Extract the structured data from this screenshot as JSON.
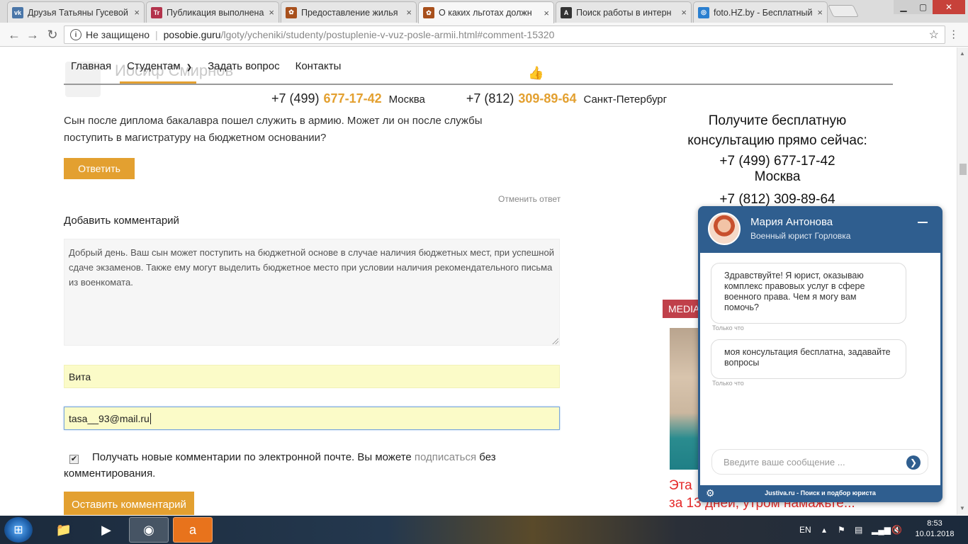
{
  "browser": {
    "tabs": [
      {
        "title": "Друзья Татьяны Гусевой",
        "favicon": "vk-icon",
        "color": "#4a76a8",
        "glyph": "vk"
      },
      {
        "title": "Публикация выполнена",
        "favicon": "tt-icon",
        "color": "#b3334c",
        "glyph": "Tr"
      },
      {
        "title": "Предоставление жилья",
        "favicon": "site-icon",
        "color": "#a8501c",
        "glyph": "✿"
      },
      {
        "title": "О каких льготах должн",
        "favicon": "site-icon",
        "color": "#a8501c",
        "glyph": "✿",
        "active": true
      },
      {
        "title": "Поиск работы в интерн",
        "favicon": "a-icon",
        "color": "#333333",
        "glyph": "A"
      },
      {
        "title": "foto.HZ.by - Бесплатный",
        "favicon": "hz-icon",
        "color": "#2a7fd0",
        "glyph": "◎"
      }
    ],
    "address": {
      "security": "Не защищено",
      "host": "posobie.guru",
      "path": "/lgoty/ycheniki/studenty/postuplenie-v-vuz-posle-armii.html#comment-15320"
    }
  },
  "page": {
    "ghost_name": "Иосиф Смирнов",
    "nav": {
      "items": [
        "Главная",
        "Студентам",
        "Задать вопрос",
        "Контакты"
      ],
      "active": "Студентам"
    },
    "phones": [
      {
        "prefix": "+7 (499)",
        "number": "677-17-42",
        "city": "Москва"
      },
      {
        "prefix": "+7 (812)",
        "number": "309-89-64",
        "city": "Санкт-Петербург"
      }
    ],
    "question": "Сын после диплома бакалавра пошел служить в армию. Может ли он после службы поступить в магистратуру на бюджетном основании?",
    "reply_button": "Ответить",
    "cancel_reply": "Отменить ответ",
    "add_comment_title": "Добавить комментарий",
    "comment_text": "Добрый день. Ваш сын может поступить на бюджетной основе в случае наличия бюджетных мест, при успешной сдаче экзаменов. Также ему могут выделить бюджетное место при условии наличия рекомендательного письма из военкомата.",
    "name_value": "Вита",
    "email_value": "tasa__93@mail.ru",
    "subscribe": {
      "checked": true,
      "text_before": "Получать новые комментарии по электронной почте. Вы можете ",
      "link": "подписаться",
      "text_after": " без комментирования."
    },
    "submit_button": "Оставить комментарий",
    "sidebar": {
      "title": "Получите бесплатную консультацию прямо сейчас:",
      "phone1": "+7 (499) 677-17-42",
      "city1": "Москва",
      "phone2": "+7 (812) 309-89-64",
      "media_tag": "MEDIA",
      "red_line1": "Эта",
      "red_line2": "за 13 дней, утром намажьте..."
    }
  },
  "chat": {
    "agent_name": "Мария Антонова",
    "agent_role": "Военный юрист Горловка",
    "messages": [
      {
        "text": "Здравствуйте! Я юрист, оказываю комплекс правовых услуг в сфере военного права. Чем я могу вам помочь?",
        "time": "Только что"
      },
      {
        "text": "моя консультация бесплатна, задавайте вопросы",
        "time": "Только что"
      }
    ],
    "input_placeholder": "Введите ваше сообщение ...",
    "footer": "Justiva.ru - Поиск и подбор юриста"
  },
  "taskbar": {
    "language": "EN",
    "time": "8:53",
    "date": "10.01.2018"
  },
  "colors": {
    "accent": "#e3a030",
    "chat_header": "#2f5e8f",
    "media_tag": "#c0404a",
    "ad_text": "#e52a2a"
  }
}
